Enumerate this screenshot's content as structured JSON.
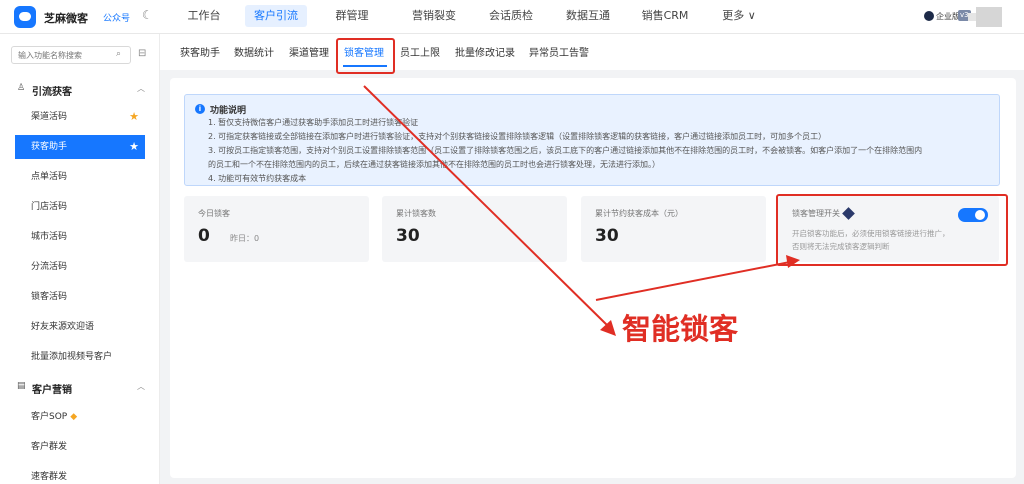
{
  "app": {
    "name": "芝麻微客",
    "tag": "公众号",
    "theme_icon": "moon-icon"
  },
  "nav": {
    "items": [
      "工作台",
      "客户引流",
      "群管理",
      "营销裂变",
      "会话质检",
      "数据互通",
      "销售CRM",
      "更多 ∨"
    ],
    "active": "客户引流"
  },
  "user": {
    "org": "企业版",
    "badge": "v3"
  },
  "sidebar": {
    "search_placeholder": "输入功能名称搜索",
    "sections": [
      {
        "title": "引流获客",
        "icon": "user-icon",
        "items": [
          "渠道活码",
          "获客助手",
          "点单活码",
          "门店活码",
          "城市活码",
          "分流活码",
          "锁客活码",
          "好友来源欢迎语",
          "批量添加视频号客户"
        ]
      },
      {
        "title": "客户营销",
        "icon": "document-icon",
        "items": [
          "客户SOP",
          "客户群发",
          "速客群发"
        ]
      }
    ],
    "active_item": "获客助手"
  },
  "subtabs": {
    "items": [
      "获客助手",
      "数据统计",
      "渠道管理",
      "锁客管理",
      "员工上限",
      "批量修改记录",
      "异常员工告警"
    ],
    "active": "锁客管理"
  },
  "info": {
    "title": "功能说明",
    "lines": [
      "1. 暂仅支持微信客户通过获客助手添加员工时进行锁客验证",
      "2. 可指定获客链接或全部链接在添加客户时进行锁客验证，支持对个别获客链接设置排除锁客逻辑（设置排除锁客逻辑的获客链接，客户通过链接添加员工时，可加多个员工）",
      "3. 可按员工指定锁客范围，支持对个别员工设置排除锁客范围（员工设置了排除锁客范围之后，该员工底下的客户通过链接添加其他不在排除范围的员工时，不会被锁客。如客户添加了一个在排除范围内",
      "的员工和一个不在排除范围内的员工，后续在通过获客链接添加其他不在排除范围的员工时也会进行锁客处理，无法进行添加。）",
      "4. 功能可有效节约获客成本"
    ]
  },
  "stats": [
    {
      "label": "今日锁客",
      "value": "0",
      "sub": "昨日：0"
    },
    {
      "label": "累计锁客数",
      "value": "30"
    },
    {
      "label": "累计节约获客成本（元）",
      "value": "30"
    }
  ],
  "lock_switch": {
    "label": "锁客管理开关",
    "enabled": true,
    "desc_1": "开启锁客功能后，必须使用锁客链接进行推广，",
    "desc_2": "否则将无法完成锁客逻辑判断"
  },
  "annotation": {
    "text": "智能锁客",
    "color": "#e02e24"
  },
  "colors": {
    "accent": "#1677ff",
    "highlight": "#e02e24"
  }
}
